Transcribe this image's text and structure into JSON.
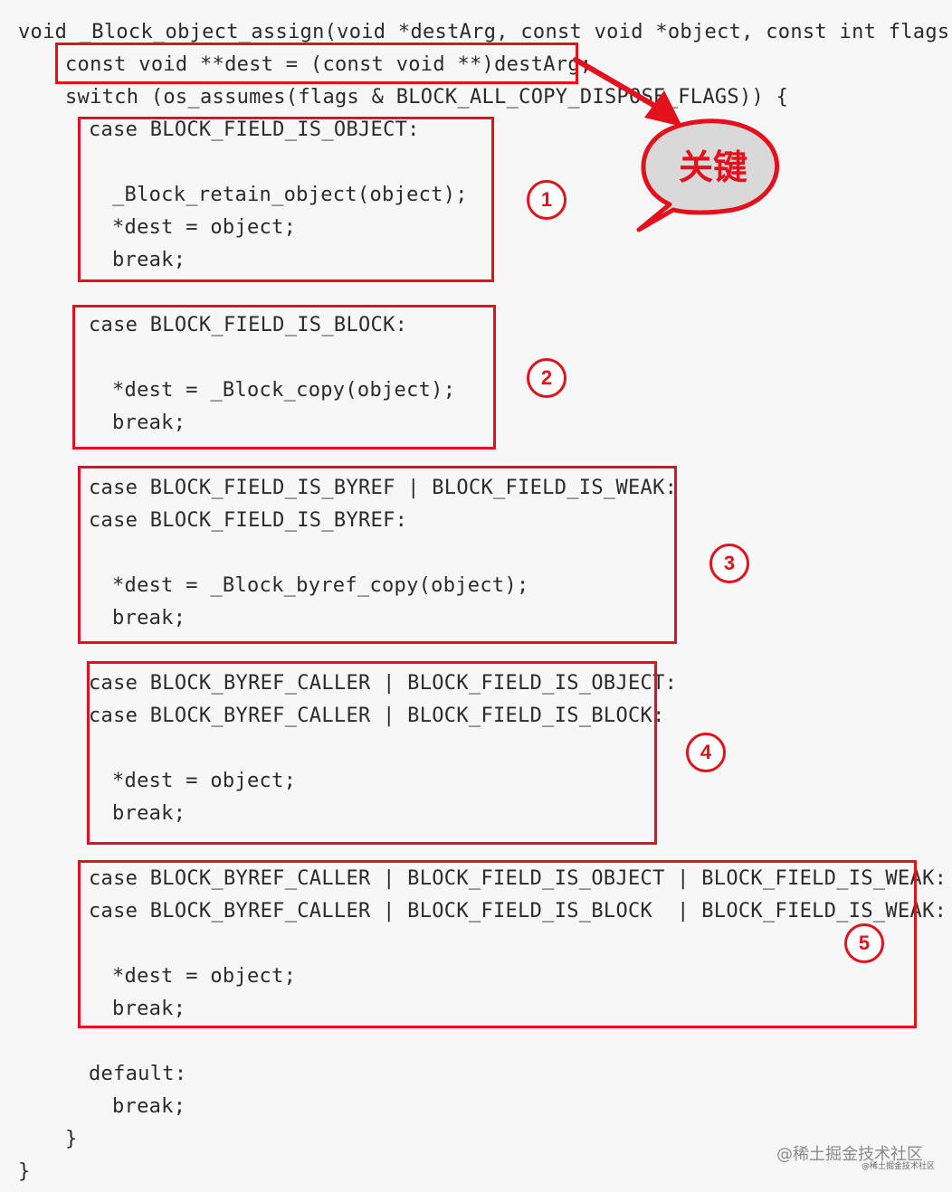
{
  "code": {
    "lines": [
      "void _Block_object_assign(void *destArg, const void *object, const int flags) {",
      "const void **dest = (const void **)destArg;",
      "switch (os_assumes(flags & BLOCK_ALL_COPY_DISPOSE_FLAGS)) {",
      "case BLOCK_FIELD_IS_OBJECT:",
      "_Block_retain_object(object);",
      "*dest = object;",
      "break;",
      "case BLOCK_FIELD_IS_BLOCK:",
      "*dest = _Block_copy(object);",
      "break;",
      "case BLOCK_FIELD_IS_BYREF | BLOCK_FIELD_IS_WEAK:",
      "case BLOCK_FIELD_IS_BYREF:",
      "*dest = _Block_byref_copy(object);",
      "break;",
      "case BLOCK_BYREF_CALLER | BLOCK_FIELD_IS_OBJECT:",
      "case BLOCK_BYREF_CALLER | BLOCK_FIELD_IS_BLOCK:",
      "*dest = object;",
      "break;",
      "case BLOCK_BYREF_CALLER | BLOCK_FIELD_IS_OBJECT | BLOCK_FIELD_IS_WEAK:",
      "case BLOCK_BYREF_CALLER | BLOCK_FIELD_IS_BLOCK  | BLOCK_FIELD_IS_WEAK:",
      "*dest = object;",
      "break;",
      "default:",
      "break;",
      "}",
      "}"
    ]
  },
  "annotations": {
    "callout_label": "关键",
    "callout_color": "#e3111b",
    "badges": [
      "1",
      "2",
      "3",
      "4",
      "5"
    ]
  },
  "watermark": {
    "text": "@稀土掘金技术社区",
    "small_text": "@稀土掘金技术社区"
  }
}
